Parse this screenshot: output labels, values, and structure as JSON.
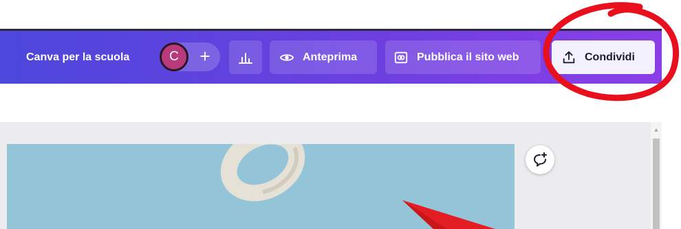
{
  "toolbar": {
    "brand_label": "Canva per la scuola",
    "avatar_initial": "C",
    "add_collaborator_symbol": "+",
    "insights_icon": "bar-chart-icon",
    "preview_label": "Anteprima",
    "preview_icon": "eye-icon",
    "publish_label": "Pubblica il sito web",
    "publish_icon": "website-icon",
    "share_label": "Condividi",
    "share_icon": "upload-icon"
  },
  "editor": {
    "comment_icon": "add-comment-icon",
    "canvas_color": "#93c4d8"
  },
  "colors": {
    "toolbar_gradient_start": "#4d47dc",
    "toolbar_gradient_end": "#8a3fe6",
    "avatar": "#b83a7a",
    "annotation": "#e8101c",
    "share_button_bg": "#f3f0ff"
  }
}
